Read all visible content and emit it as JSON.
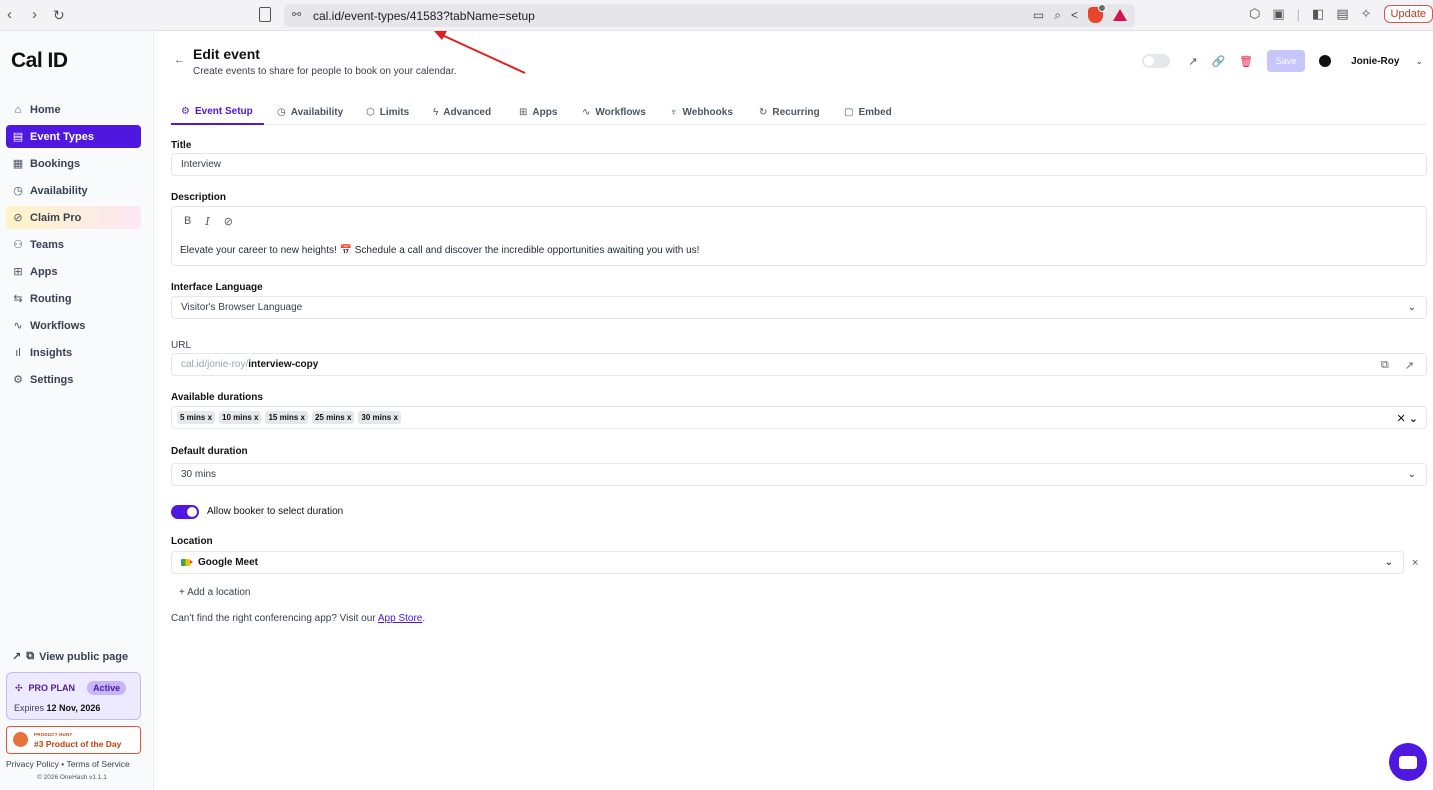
{
  "browser": {
    "url": "cal.id/event-types/41583?tabName=setup",
    "update_label": "Update"
  },
  "sidebar": {
    "logo": "Cal ID",
    "items": [
      {
        "label": "Home",
        "icon": "⌂",
        "active": false
      },
      {
        "label": "Event Types",
        "icon": "▤",
        "active": true
      },
      {
        "label": "Bookings",
        "icon": "▦",
        "active": false
      },
      {
        "label": "Availability",
        "icon": "◷",
        "active": false
      },
      {
        "label": "Claim Pro",
        "icon": "⊘",
        "active": false
      },
      {
        "label": "Teams",
        "icon": "⚇",
        "active": false
      },
      {
        "label": "Apps",
        "icon": "⊞",
        "active": false
      },
      {
        "label": "Routing",
        "icon": "⇆",
        "active": false
      },
      {
        "label": "Workflows",
        "icon": "∿",
        "active": false
      },
      {
        "label": "Insights",
        "icon": "ıl",
        "active": false
      },
      {
        "label": "Settings",
        "icon": "⚙",
        "active": false
      }
    ],
    "view_public_page": "View public page",
    "plan": {
      "name": "PRO PLAN",
      "status": "Active",
      "expires_label": "Expires",
      "expires_date": "12 Nov, 2026"
    },
    "product_hunt": {
      "small": "PRODUCT HUNT",
      "big": "#3 Product of the Day"
    },
    "legal": "Privacy Policy • Terms of Service",
    "copyright": "© 2026 OneHash v1.1.1"
  },
  "header": {
    "title": "Edit event",
    "subtitle": "Create events to share for people to book on your calendar.",
    "save_label": "Save",
    "user_name": "Jonie-Roy"
  },
  "tabs": [
    {
      "label": "Event Setup",
      "icon": "⚙"
    },
    {
      "label": "Availability",
      "icon": "◷"
    },
    {
      "label": "Limits",
      "icon": "⬡"
    },
    {
      "label": "Advanced",
      "icon": "ϟ"
    },
    {
      "label": "Apps",
      "icon": "⊞"
    },
    {
      "label": "Workflows",
      "icon": "∿"
    },
    {
      "label": "Webhooks",
      "icon": "♆"
    },
    {
      "label": "Recurring",
      "icon": "↻"
    },
    {
      "label": "Embed",
      "icon": "▢"
    }
  ],
  "form": {
    "title_label": "Title",
    "title_value": "Interview",
    "description_label": "Description",
    "description_value": "Elevate your career to new heights! 📅 Schedule a call and discover the incredible opportunities awaiting you with us!",
    "language_label": "Interface Language",
    "language_value": "Visitor's Browser Language",
    "url_label": "URL",
    "url_prefix": "cal.id/jonie-roy/",
    "url_slug": "interview-copy",
    "durations_label": "Available durations",
    "durations": [
      "5 mins x",
      "10 mins x",
      "15 mins x",
      "25 mins x",
      "30 mins x"
    ],
    "default_duration_label": "Default duration",
    "default_duration_value": "30 mins",
    "allow_booker_label": "Allow booker to select duration",
    "location_label": "Location",
    "location_value": "Google Meet",
    "add_location": "+ Add a location",
    "app_store_prefix": "Can't find the right conferencing app? Visit our",
    "app_store_link": "App Store",
    "app_store_suffix": "."
  }
}
